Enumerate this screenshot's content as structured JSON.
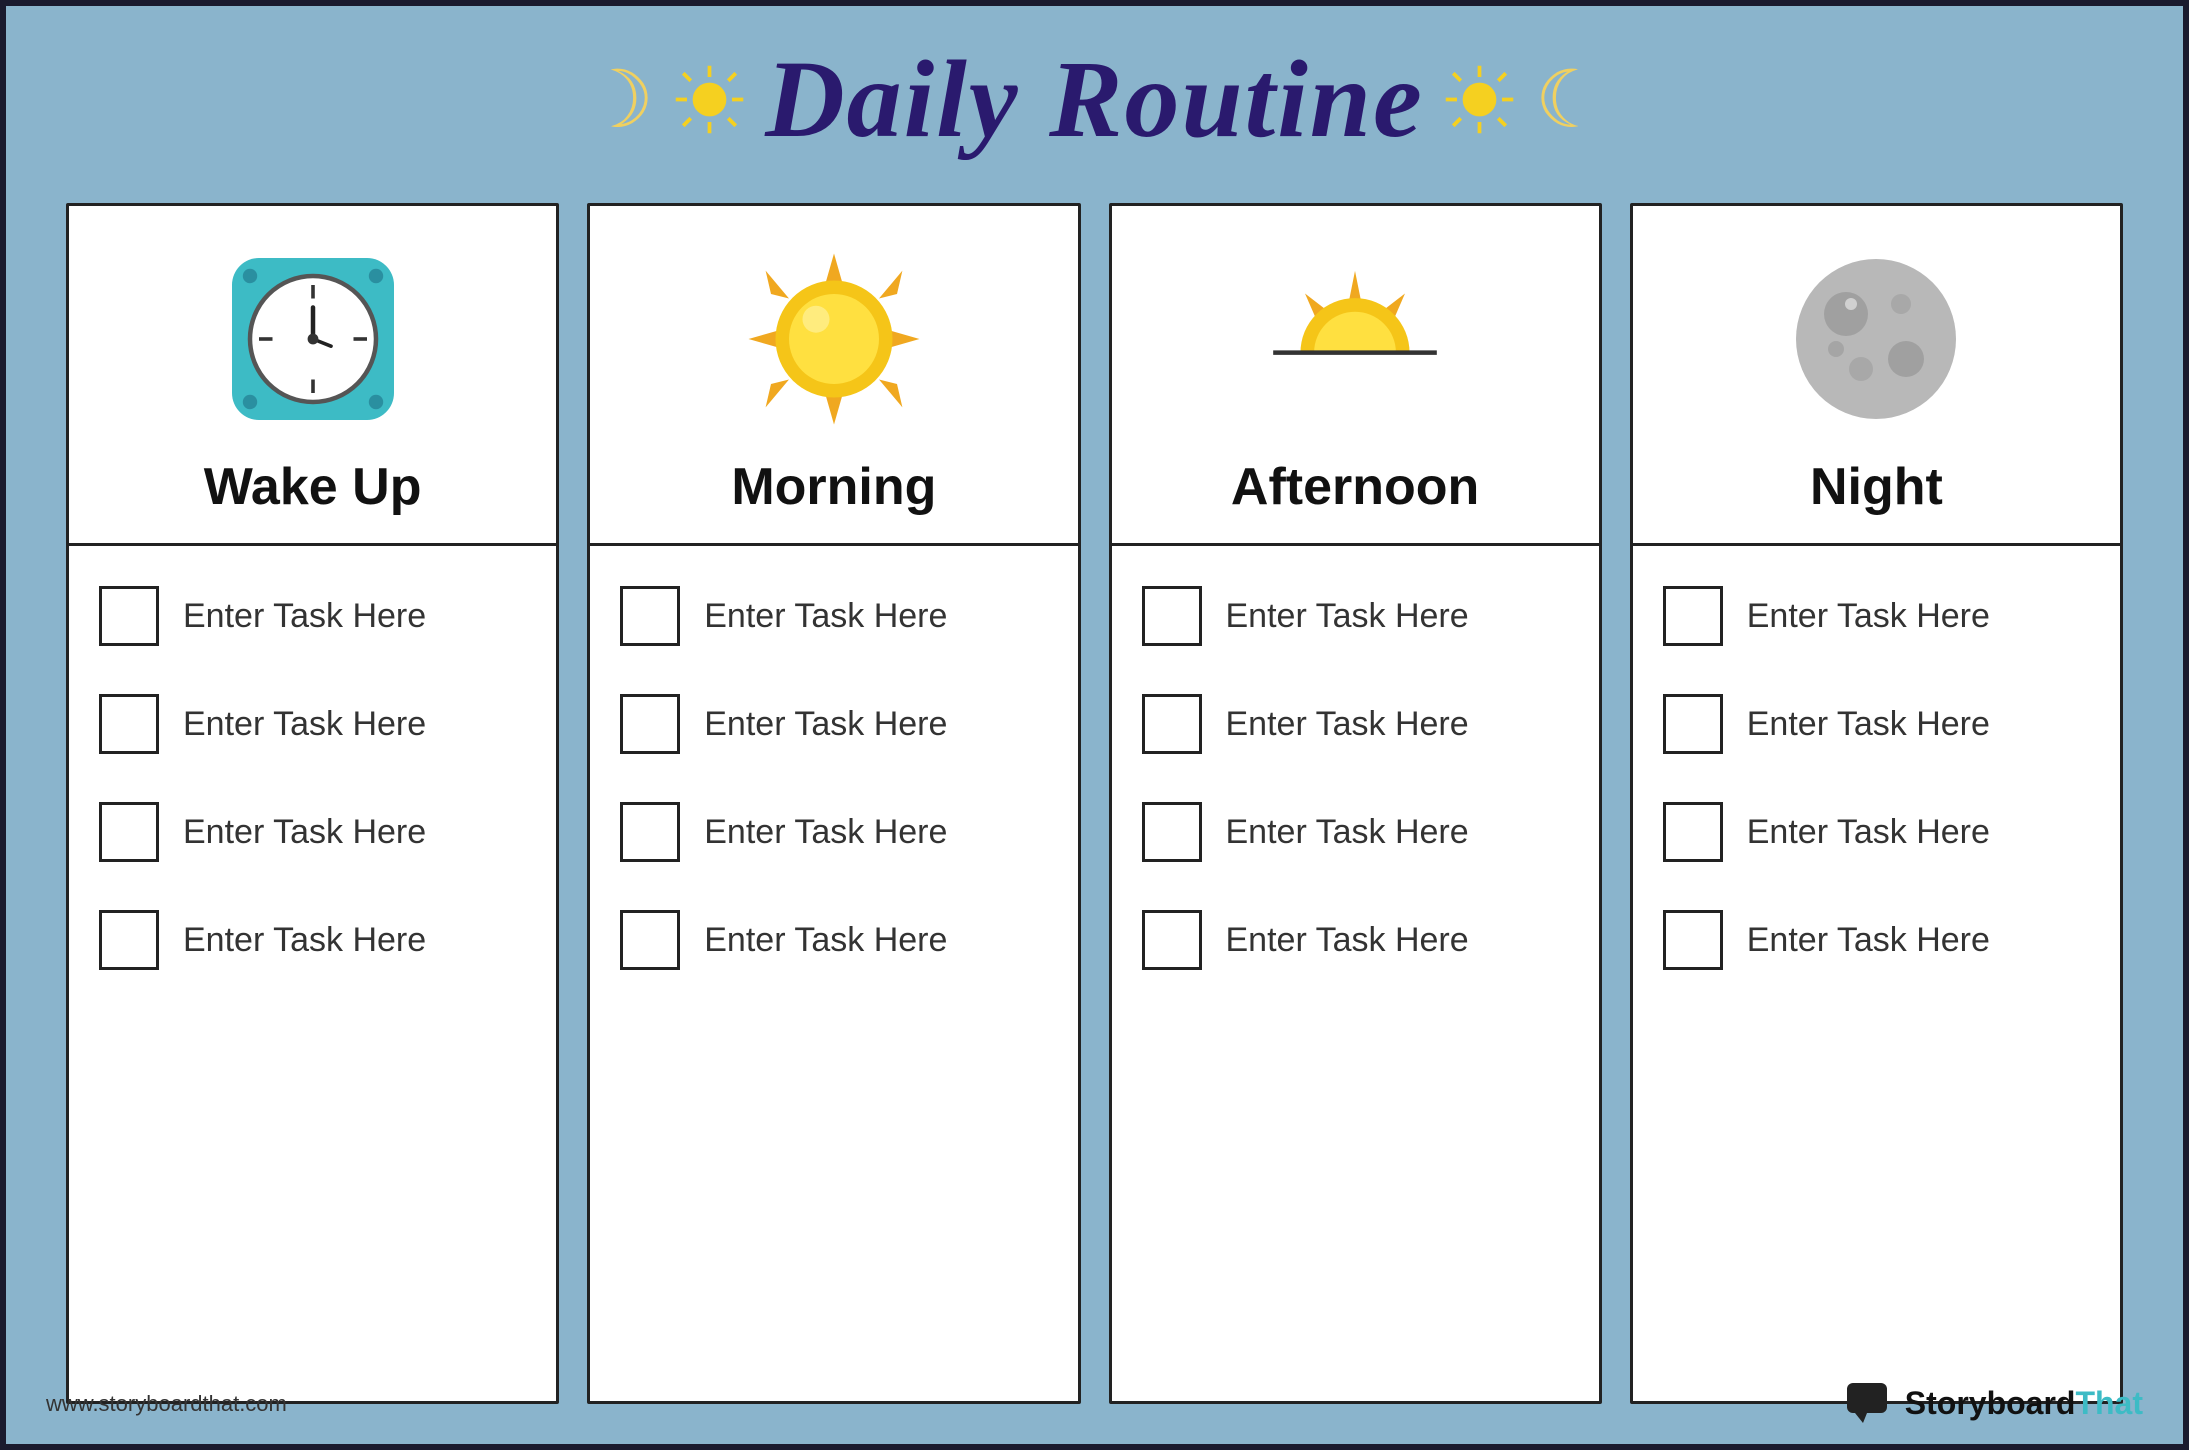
{
  "header": {
    "title": "Daily Routine",
    "moon_symbol": "☽",
    "sun_symbol": "✦",
    "right_moon_symbol": "☾"
  },
  "columns": [
    {
      "id": "wake-up",
      "title": "Wake Up",
      "icon_type": "clock",
      "tasks": [
        "Enter Task Here",
        "Enter Task Here",
        "Enter Task Here",
        "Enter Task Here"
      ]
    },
    {
      "id": "morning",
      "title": "Morning",
      "icon_type": "sun",
      "tasks": [
        "Enter Task Here",
        "Enter Task Here",
        "Enter Task Here",
        "Enter Task Here"
      ]
    },
    {
      "id": "afternoon",
      "title": "Afternoon",
      "icon_type": "afternoon",
      "tasks": [
        "Enter Task Here",
        "Enter Task Here",
        "Enter Task Here",
        "Enter Task Here"
      ]
    },
    {
      "id": "night",
      "title": "Night",
      "icon_type": "moon",
      "tasks": [
        "Enter Task Here",
        "Enter Task Here",
        "Enter Task Here",
        "Enter Task Here"
      ]
    }
  ],
  "footer": {
    "url": "www.storyboardthat.com",
    "brand_name": "Storyboard",
    "brand_suffix": "That"
  }
}
